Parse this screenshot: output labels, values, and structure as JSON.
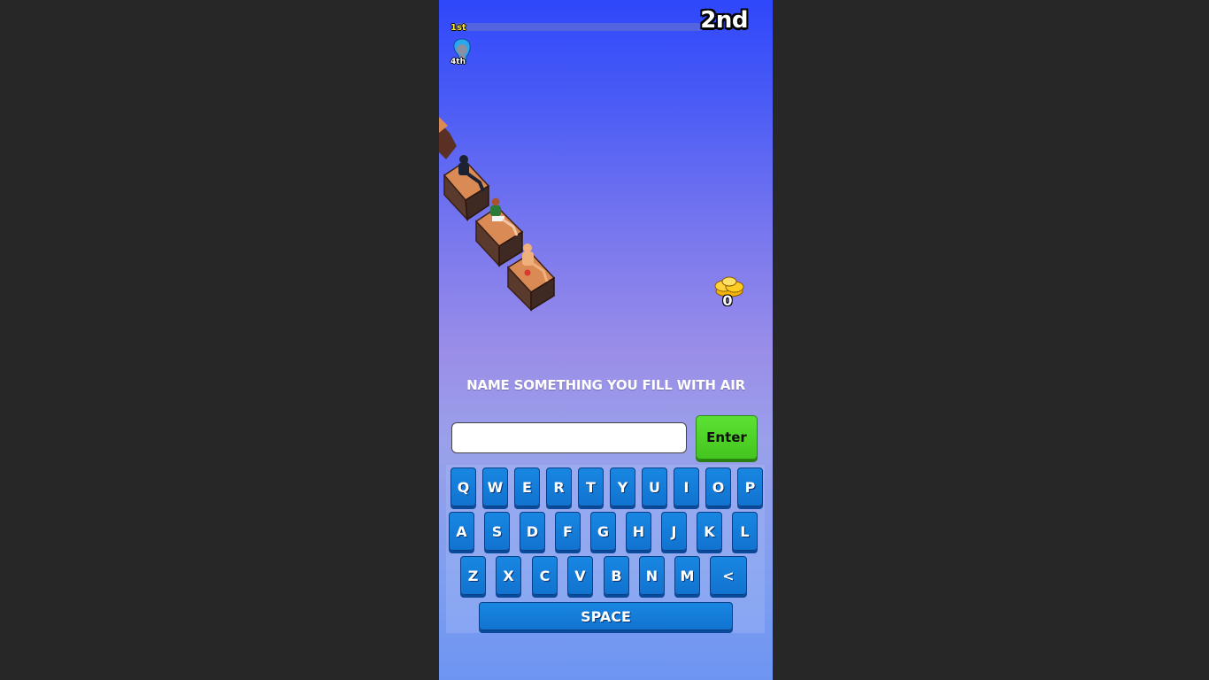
{
  "race": {
    "leader_rank": "1st",
    "current_rank": "2nd",
    "player_rank": "4th",
    "progress_fraction": 0.0
  },
  "coins": {
    "count": "0",
    "icon": "gold-coin-stack-icon"
  },
  "question": {
    "text": "NAME SOMETHING YOU FILL WITH AIR"
  },
  "answer": {
    "value": "",
    "placeholder": ""
  },
  "enter_button": {
    "label": "Enter"
  },
  "keyboard": {
    "row1": [
      "Q",
      "W",
      "E",
      "R",
      "T",
      "Y",
      "U",
      "I",
      "O",
      "P"
    ],
    "row2": [
      "A",
      "S",
      "D",
      "F",
      "G",
      "H",
      "J",
      "K",
      "L"
    ],
    "row3": [
      "Z",
      "X",
      "C",
      "V",
      "B",
      "N",
      "M",
      "<"
    ],
    "space_label": "SPACE"
  },
  "colors": {
    "key": "#1173cf",
    "enter": "#44c41f",
    "rank_leader": "#ffe83a",
    "background_top": "#2f47fb",
    "background_bottom": "#6d95f2"
  }
}
